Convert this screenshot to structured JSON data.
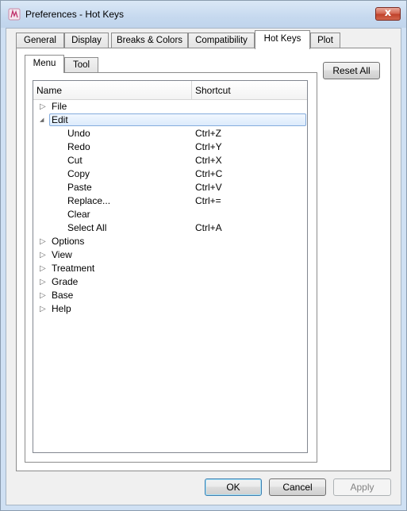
{
  "window": {
    "title": "Preferences - Hot Keys",
    "close_glyph": "x"
  },
  "main_tabs": [
    {
      "label": "General",
      "active": false
    },
    {
      "label": "Display",
      "active": false
    },
    {
      "label": "Breaks & Colors",
      "active": false
    },
    {
      "label": "Compatibility",
      "active": false
    },
    {
      "label": "Hot Keys",
      "active": true
    },
    {
      "label": "Plot",
      "active": false
    }
  ],
  "sub_tabs": [
    {
      "label": "Menu",
      "active": true
    },
    {
      "label": "Tool",
      "active": false
    }
  ],
  "tree": {
    "columns": {
      "name": "Name",
      "shortcut": "Shortcut"
    },
    "rows": [
      {
        "name": "File",
        "shortcut": "",
        "level": 0,
        "expander": "▷"
      },
      {
        "name": "Edit",
        "shortcut": "",
        "level": 0,
        "expander": "◢",
        "selected": true
      },
      {
        "name": "Undo",
        "shortcut": "Ctrl+Z",
        "level": 1
      },
      {
        "name": "Redo",
        "shortcut": "Ctrl+Y",
        "level": 1
      },
      {
        "name": "Cut",
        "shortcut": "Ctrl+X",
        "level": 1
      },
      {
        "name": "Copy",
        "shortcut": "Ctrl+C",
        "level": 1
      },
      {
        "name": "Paste",
        "shortcut": "Ctrl+V",
        "level": 1
      },
      {
        "name": "Replace...",
        "shortcut": "Ctrl+=",
        "level": 1
      },
      {
        "name": "Clear",
        "shortcut": "",
        "level": 1
      },
      {
        "name": "Select All",
        "shortcut": "Ctrl+A",
        "level": 1
      },
      {
        "name": "Options",
        "shortcut": "",
        "level": 0,
        "expander": "▷"
      },
      {
        "name": "View",
        "shortcut": "",
        "level": 0,
        "expander": "▷"
      },
      {
        "name": "Treatment",
        "shortcut": "",
        "level": 0,
        "expander": "▷"
      },
      {
        "name": "Grade",
        "shortcut": "",
        "level": 0,
        "expander": "▷"
      },
      {
        "name": "Base",
        "shortcut": "",
        "level": 0,
        "expander": "▷"
      },
      {
        "name": "Help",
        "shortcut": "",
        "level": 0,
        "expander": "▷"
      }
    ]
  },
  "buttons": {
    "reset_all": "Reset All",
    "ok": "OK",
    "cancel": "Cancel",
    "apply": "Apply"
  },
  "icons": {
    "app": "app-logo-icon",
    "close": "close-icon",
    "collapsed": "triangle-right-icon",
    "expanded": "triangle-down-icon"
  },
  "colors": {
    "title_bar": "#c6d9ef",
    "selection_border": "#84acdd",
    "close_button": "#c0432c"
  }
}
